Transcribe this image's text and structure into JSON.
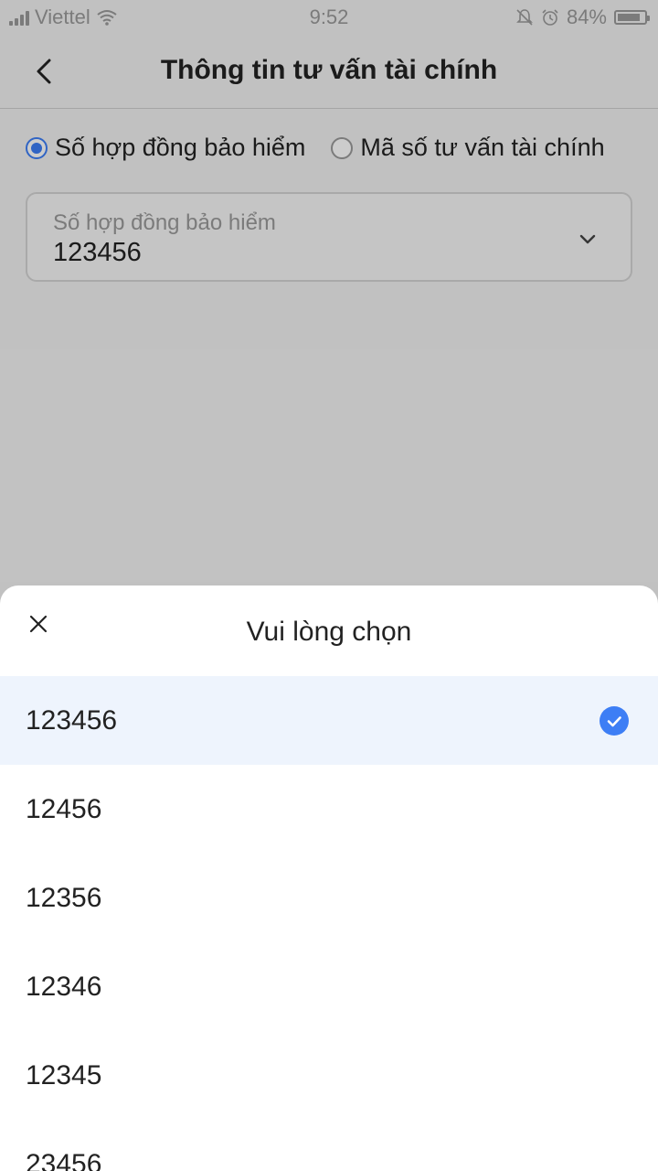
{
  "status_bar": {
    "carrier": "Viettel",
    "time": "9:52",
    "battery": "84%",
    "battery_level": 0.84
  },
  "header": {
    "title": "Thông tin tư vấn tài chính"
  },
  "search_type": {
    "options": [
      {
        "label": "Số hợp đồng bảo hiểm",
        "checked": true
      },
      {
        "label": "Mã số tư vấn tài chính",
        "checked": false
      }
    ]
  },
  "contract_field": {
    "label": "Số hợp đồng bảo hiểm",
    "value": "123456"
  },
  "picker": {
    "title": "Vui lòng chọn",
    "options": [
      "123456",
      "12456",
      "12356",
      "12346",
      "12345",
      "23456"
    ],
    "selected": "123456"
  },
  "colors": {
    "accent": "#3d7ef5",
    "selected_row": "#eef4fd"
  },
  "icons": [
    "signal-icon",
    "wifi-icon",
    "mute-icon",
    "alarm-icon",
    "battery-icon",
    "back-icon",
    "chevron-down-icon",
    "close-icon",
    "check-icon"
  ]
}
